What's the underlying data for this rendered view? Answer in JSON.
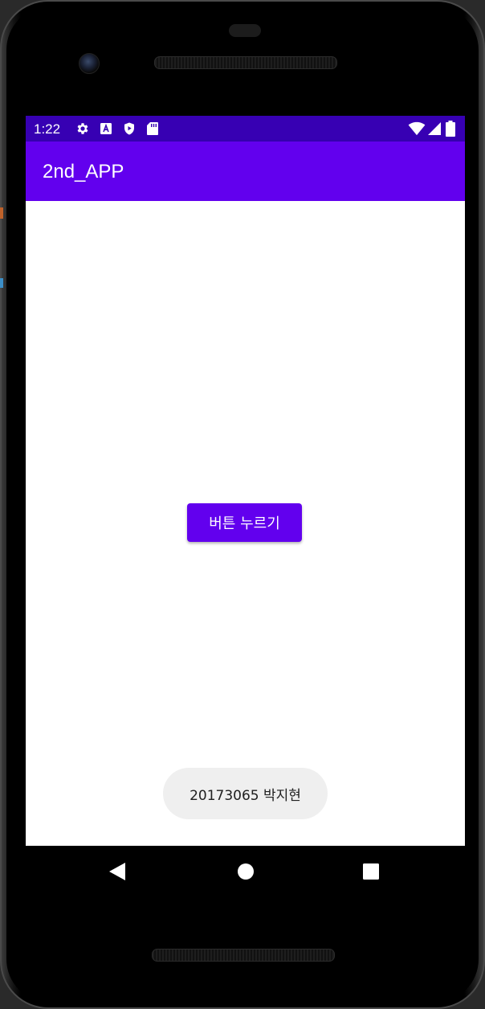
{
  "status_bar": {
    "time": "1:22",
    "icons": [
      "gear-icon",
      "a-box-icon",
      "shield-play-icon",
      "sd-card-icon",
      "wifi-icon",
      "signal-icon",
      "battery-icon"
    ],
    "color": "#3700b3"
  },
  "app_bar": {
    "title": "2nd_APP",
    "color": "#6200ee"
  },
  "main": {
    "button_label": "버튼 누르기"
  },
  "toast": {
    "text": "20173065 박지현"
  },
  "nav_bar": {
    "buttons": [
      "back-icon",
      "home-icon",
      "recents-icon"
    ]
  }
}
